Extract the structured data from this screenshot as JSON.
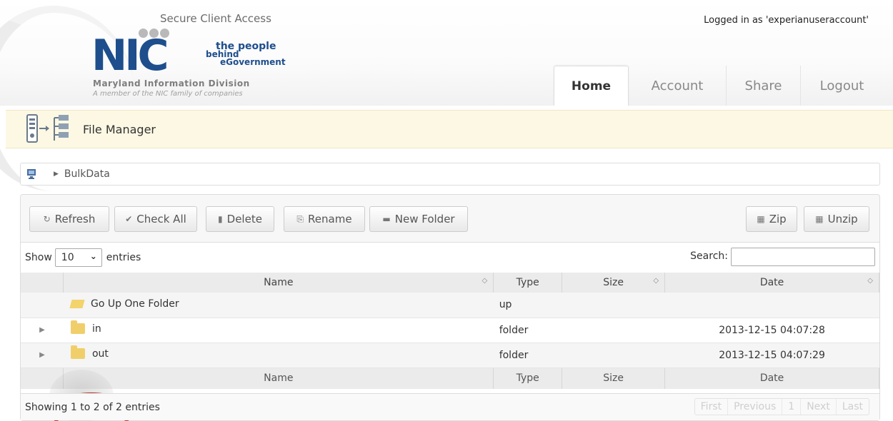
{
  "header": {
    "brand_subtitle": "Secure Client Access",
    "logo_text": "NIC",
    "logo_tagline": [
      "the people",
      "behind",
      "eGovernment"
    ],
    "division": "Maryland Information Division",
    "member_note": "A member of the NIC family of companies",
    "logged_in": "Logged in as 'experianuseraccount'"
  },
  "nav": {
    "tabs": [
      {
        "label": "Home",
        "active": true
      },
      {
        "label": "Account",
        "active": false
      },
      {
        "label": "Share",
        "active": false
      },
      {
        "label": "Logout",
        "active": false
      }
    ]
  },
  "file_manager": {
    "title": "File Manager"
  },
  "breadcrumb": {
    "folder": "BulkData"
  },
  "toolbar": {
    "refresh": "Refresh",
    "check_all": "Check All",
    "delete": "Delete",
    "rename": "Rename",
    "new_folder": "New Folder",
    "zip": "Zip",
    "unzip": "Unzip"
  },
  "table": {
    "show_label": "Show",
    "page_size": "10",
    "entries_label": "entries",
    "search_label": "Search:",
    "search_value": "",
    "columns": [
      "Name",
      "Type",
      "Size",
      "Date"
    ],
    "rows": [
      {
        "name": "Go Up One Folder",
        "type": "up",
        "size": "",
        "date": ""
      },
      {
        "name": "in",
        "type": "folder",
        "size": "",
        "date": "2013-12-15 04:07:28"
      },
      {
        "name": "out",
        "type": "folder",
        "size": "",
        "date": "2013-12-15 04:07:29"
      }
    ],
    "status": "Showing 1 to 2 of 2 entries",
    "pager": [
      "First",
      "Previous",
      "1",
      "Next",
      "Last"
    ]
  },
  "colors": {
    "brand": "#1e4e8c",
    "highlight_ring": "#b23a2a",
    "fm_bar_bg": "#fcf8e3"
  }
}
